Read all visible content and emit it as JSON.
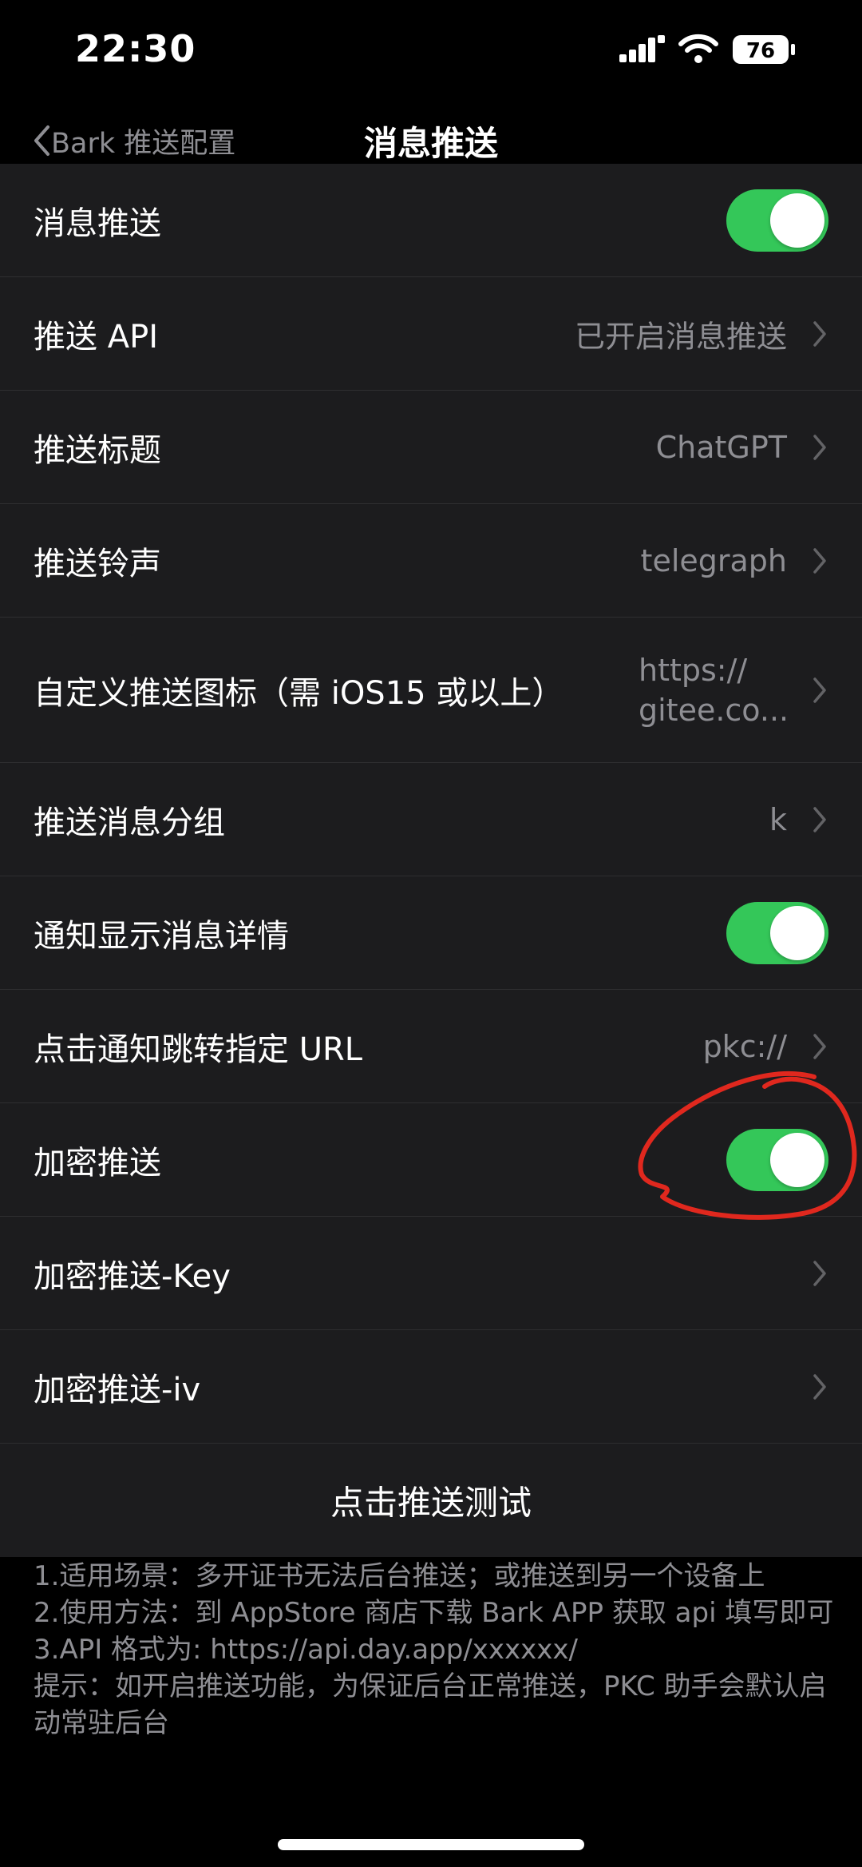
{
  "status_bar": {
    "time": "22:30",
    "battery": "76",
    "icons": [
      "signal-icon",
      "wifi-icon",
      "battery-icon"
    ]
  },
  "nav": {
    "back_label": "Bark 推送配置",
    "title": "消息推送"
  },
  "rows": [
    {
      "label": "消息推送",
      "type": "toggle",
      "on": true
    },
    {
      "label": "推送 API",
      "value": "已开启消息推送"
    },
    {
      "label": "推送标题",
      "value": "ChatGPT"
    },
    {
      "label": "推送铃声",
      "value": "telegraph"
    },
    {
      "label": "自定义推送图标（需 iOS15 或以上）",
      "value_line1": "https://",
      "value_line2": "gitee.co..."
    },
    {
      "label": "推送消息分组",
      "value": "k"
    },
    {
      "label": "通知显示消息详情",
      "type": "toggle",
      "on": true
    },
    {
      "label": "点击通知跳转指定 URL",
      "value": "pkc://"
    },
    {
      "label": "加密推送",
      "type": "toggle",
      "on": true
    },
    {
      "label": "加密推送-Key",
      "value": ""
    },
    {
      "label": "加密推送-iv",
      "value": ""
    }
  ],
  "test_button": "点击推送测试",
  "notes": [
    "1.适用场景：多开证书无法后台推送；或推送到另一个设备上",
    "2.使用方法：到 AppStore 商店下载 Bark APP 获取 api 填写即可",
    "3.API 格式为: https://api.day.app/xxxxxx/",
    "提示：如开启推送功能，为保证后台正常推送，PKC 助手会默认启动常驻后台"
  ],
  "colors": {
    "background": "#000000",
    "cell": "#1c1c1e",
    "toggle_on": "#34c759",
    "secondary_text": "#8e8e93",
    "annotation": "#e0281e"
  }
}
